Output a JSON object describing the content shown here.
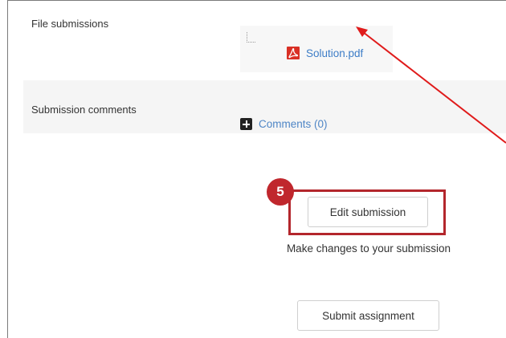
{
  "submission": {
    "file_submissions_label": "File submissions",
    "file_name": "Solution.pdf",
    "submission_comments_label": "Submission comments",
    "comments_link": "Comments (0)"
  },
  "actions": {
    "edit_button": "Edit submission",
    "edit_description": "Make changes to your submission",
    "submit_button": "Submit assignment"
  },
  "annotation": {
    "step_number": "5",
    "color": "#c0272d"
  },
  "colors": {
    "link": "#3d7dc7",
    "row_alt_bg": "#f5f5f5"
  },
  "icons": {
    "file": "pdf-icon",
    "comments": "plus-square-icon"
  }
}
